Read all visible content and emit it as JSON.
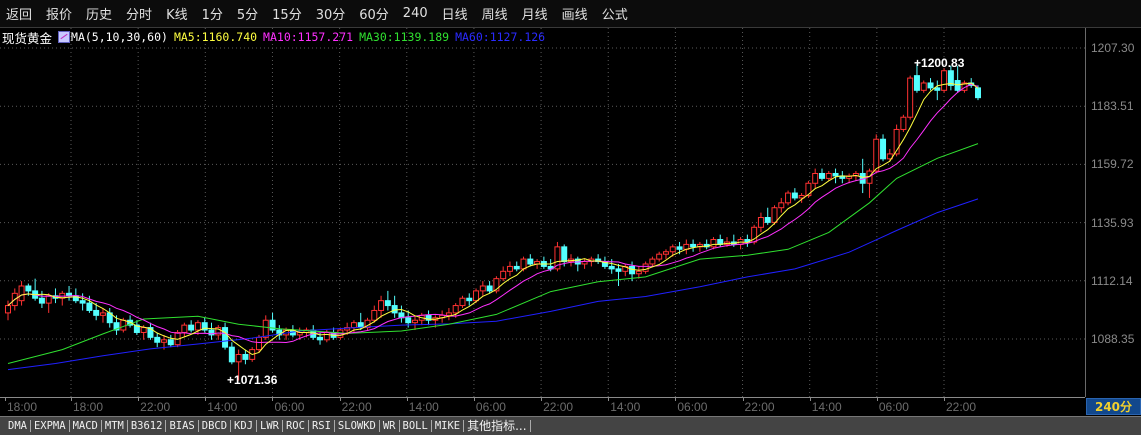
{
  "toolbar": {
    "items": [
      "返回",
      "报价",
      "历史",
      "分时",
      "K线",
      "1分",
      "5分",
      "15分",
      "30分",
      "60分",
      "240",
      "日线",
      "周线",
      "月线",
      "画线",
      "公式"
    ]
  },
  "info": {
    "symbol": "现货黄金",
    "indicator_icon": "indicator-icon",
    "ma_label": "MA(5,10,30,60)",
    "ma5": "MA5:1160.740",
    "ma10": "MA10:1157.271",
    "ma30": "MA30:1139.189",
    "ma60": "MA60:1127.126"
  },
  "period_badge": "240分",
  "indicator_tabs": [
    "DMA",
    "EXPMA",
    "MACD",
    "MTM",
    "B3612",
    "BIAS",
    "DBCD",
    "KDJ",
    "LWR",
    "ROC",
    "RSI",
    "SLOWKD",
    "WR",
    "BOLL",
    "MIKE",
    "其他指标..."
  ],
  "colors": {
    "up": "#ff3232",
    "down": "#54ffff",
    "ma5": "#ffff40",
    "ma10": "#ff30ff",
    "ma30": "#30e030",
    "ma60": "#2020ff",
    "grid": "#5a5a5a"
  },
  "chart_data": {
    "type": "candlestick",
    "y_ticks": [
      "1207.30",
      "1183.51",
      "1159.72",
      "1135.93",
      "1112.14",
      "1088.35"
    ],
    "ylim": [
      1060,
      1215
    ],
    "x_ticks": [
      "18:00",
      "18:00",
      "22:00",
      "14:00",
      "06:00",
      "22:00",
      "14:00",
      "06:00",
      "22:00",
      "14:00",
      "06:00",
      "22:00",
      "14:00",
      "06:00",
      "22:00"
    ],
    "annotations": {
      "high": "1200.83",
      "low": "1071.36"
    },
    "candles_ohlc": [
      [
        1099,
        1104,
        1096,
        1102
      ],
      [
        1102,
        1109,
        1100,
        1107
      ],
      [
        1104,
        1112,
        1102,
        1110
      ],
      [
        1110,
        1111,
        1106,
        1108
      ],
      [
        1108,
        1113,
        1104,
        1105
      ],
      [
        1105,
        1108,
        1101,
        1103
      ],
      [
        1103,
        1107,
        1099,
        1106
      ],
      [
        1106,
        1109,
        1103,
        1105
      ],
      [
        1105,
        1108,
        1102,
        1107
      ],
      [
        1107,
        1110,
        1104,
        1106
      ],
      [
        1106,
        1109,
        1103,
        1104
      ],
      [
        1104,
        1107,
        1100,
        1103
      ],
      [
        1103,
        1106,
        1099,
        1100
      ],
      [
        1100,
        1103,
        1096,
        1098
      ],
      [
        1098,
        1101,
        1095,
        1099
      ],
      [
        1099,
        1101,
        1093,
        1095
      ],
      [
        1095,
        1098,
        1090,
        1092
      ],
      [
        1092,
        1097,
        1091,
        1096
      ],
      [
        1096,
        1098,
        1093,
        1094
      ],
      [
        1094,
        1096,
        1090,
        1091
      ],
      [
        1091,
        1094,
        1088,
        1093
      ],
      [
        1093,
        1095,
        1088,
        1089
      ],
      [
        1089,
        1091,
        1085,
        1087
      ],
      [
        1087,
        1090,
        1084,
        1088
      ],
      [
        1088,
        1090,
        1085,
        1086
      ],
      [
        1086,
        1092,
        1085,
        1091
      ],
      [
        1091,
        1095,
        1089,
        1094
      ],
      [
        1094,
        1096,
        1091,
        1092
      ],
      [
        1092,
        1096,
        1090,
        1095
      ],
      [
        1095,
        1097,
        1091,
        1092
      ],
      [
        1092,
        1095,
        1088,
        1090
      ],
      [
        1090,
        1094,
        1088,
        1093
      ],
      [
        1093,
        1095,
        1084,
        1085
      ],
      [
        1085,
        1087,
        1078,
        1079
      ],
      [
        1079,
        1084,
        1071.36,
        1082
      ],
      [
        1082,
        1084,
        1078,
        1080
      ],
      [
        1080,
        1085,
        1079,
        1084
      ],
      [
        1084,
        1090,
        1083,
        1089
      ],
      [
        1089,
        1098,
        1088,
        1096
      ],
      [
        1096,
        1099,
        1091,
        1092
      ],
      [
        1092,
        1094,
        1088,
        1090
      ],
      [
        1090,
        1093,
        1088,
        1092
      ],
      [
        1092,
        1094,
        1089,
        1090
      ],
      [
        1090,
        1093,
        1088,
        1091
      ],
      [
        1091,
        1093,
        1089,
        1092
      ],
      [
        1092,
        1094,
        1088,
        1089
      ],
      [
        1089,
        1091,
        1086,
        1088
      ],
      [
        1088,
        1092,
        1087,
        1091
      ],
      [
        1091,
        1093,
        1088,
        1089
      ],
      [
        1089,
        1093,
        1088,
        1092
      ],
      [
        1092,
        1095,
        1090,
        1093
      ],
      [
        1093,
        1096,
        1091,
        1095
      ],
      [
        1095,
        1099,
        1092,
        1093
      ],
      [
        1093,
        1097,
        1092,
        1096
      ],
      [
        1096,
        1102,
        1095,
        1100
      ],
      [
        1100,
        1106,
        1097,
        1104
      ],
      [
        1104,
        1108,
        1100,
        1102
      ],
      [
        1102,
        1106,
        1097,
        1099
      ],
      [
        1099,
        1102,
        1095,
        1097
      ],
      [
        1097,
        1100,
        1093,
        1095
      ],
      [
        1095,
        1098,
        1092,
        1096
      ],
      [
        1096,
        1099,
        1094,
        1098
      ],
      [
        1098,
        1100,
        1094,
        1096
      ],
      [
        1096,
        1098,
        1093,
        1097
      ],
      [
        1097,
        1100,
        1095,
        1098
      ],
      [
        1098,
        1101,
        1096,
        1099
      ],
      [
        1099,
        1103,
        1097,
        1102
      ],
      [
        1102,
        1106,
        1101,
        1105
      ],
      [
        1105,
        1107,
        1102,
        1104
      ],
      [
        1104,
        1109,
        1103,
        1108
      ],
      [
        1108,
        1112,
        1106,
        1110
      ],
      [
        1110,
        1112,
        1107,
        1108
      ],
      [
        1108,
        1114,
        1107,
        1113
      ],
      [
        1113,
        1118,
        1112,
        1116
      ],
      [
        1116,
        1120,
        1114,
        1118
      ],
      [
        1118,
        1120,
        1116,
        1117
      ],
      [
        1117,
        1122,
        1116,
        1121
      ],
      [
        1121,
        1123,
        1118,
        1119
      ],
      [
        1119,
        1121,
        1117,
        1120
      ],
      [
        1120,
        1122,
        1117,
        1118
      ],
      [
        1118,
        1121,
        1116,
        1117
      ],
      [
        1117,
        1128,
        1116,
        1126
      ],
      [
        1126,
        1127,
        1118,
        1120
      ],
      [
        1120,
        1123,
        1118,
        1121
      ],
      [
        1121,
        1122,
        1116,
        1119
      ],
      [
        1119,
        1121,
        1117,
        1120
      ],
      [
        1120,
        1122,
        1118,
        1121
      ],
      [
        1121,
        1123,
        1119,
        1120
      ],
      [
        1120,
        1122,
        1117,
        1118
      ],
      [
        1118,
        1121,
        1115,
        1117
      ],
      [
        1117,
        1119,
        1110,
        1116
      ],
      [
        1116,
        1119,
        1114,
        1118
      ],
      [
        1118,
        1120,
        1112,
        1115
      ],
      [
        1115,
        1118,
        1113,
        1116
      ],
      [
        1116,
        1120,
        1115,
        1119
      ],
      [
        1119,
        1122,
        1118,
        1121
      ],
      [
        1121,
        1124,
        1120,
        1123
      ],
      [
        1123,
        1125,
        1121,
        1124
      ],
      [
        1124,
        1127,
        1122,
        1126
      ],
      [
        1126,
        1128,
        1123,
        1125
      ],
      [
        1125,
        1129,
        1123,
        1127
      ],
      [
        1127,
        1129,
        1124,
        1126
      ],
      [
        1126,
        1128,
        1124,
        1127
      ],
      [
        1127,
        1129,
        1125,
        1126
      ],
      [
        1126,
        1130,
        1125,
        1129
      ],
      [
        1129,
        1131,
        1126,
        1127
      ],
      [
        1127,
        1130,
        1126,
        1128
      ],
      [
        1128,
        1131,
        1126,
        1127
      ],
      [
        1127,
        1130,
        1125,
        1129
      ],
      [
        1129,
        1131,
        1126,
        1128
      ],
      [
        1128,
        1135,
        1127,
        1134
      ],
      [
        1134,
        1140,
        1132,
        1138
      ],
      [
        1138,
        1142,
        1135,
        1136
      ],
      [
        1136,
        1143,
        1135,
        1142
      ],
      [
        1142,
        1146,
        1140,
        1144
      ],
      [
        1144,
        1149,
        1143,
        1148
      ],
      [
        1148,
        1150,
        1145,
        1146
      ],
      [
        1146,
        1148,
        1144,
        1147
      ],
      [
        1147,
        1153,
        1146,
        1152
      ],
      [
        1152,
        1158,
        1150,
        1156
      ],
      [
        1156,
        1158,
        1153,
        1154
      ],
      [
        1154,
        1157,
        1153,
        1156
      ],
      [
        1156,
        1158,
        1152,
        1155
      ],
      [
        1155,
        1157,
        1152,
        1154
      ],
      [
        1154,
        1156,
        1152,
        1155
      ],
      [
        1155,
        1157,
        1153,
        1156
      ],
      [
        1156,
        1162,
        1148,
        1152
      ],
      [
        1152,
        1158,
        1146,
        1157
      ],
      [
        1157,
        1172,
        1156,
        1170
      ],
      [
        1170,
        1172,
        1161,
        1162
      ],
      [
        1162,
        1166,
        1161,
        1164
      ],
      [
        1164,
        1176,
        1163,
        1174
      ],
      [
        1174,
        1180,
        1173,
        1179
      ],
      [
        1179,
        1196,
        1178,
        1195
      ],
      [
        1196,
        1200.83,
        1189,
        1190
      ],
      [
        1190,
        1194,
        1189,
        1193
      ],
      [
        1193,
        1195,
        1190,
        1191
      ],
      [
        1191,
        1194,
        1186,
        1190
      ],
      [
        1190,
        1199,
        1189,
        1198
      ],
      [
        1198,
        1200,
        1190,
        1192
      ],
      [
        1194,
        1200,
        1189,
        1190
      ],
      [
        1190,
        1194,
        1189,
        1193
      ],
      [
        1193,
        1195,
        1191,
        1192
      ],
      [
        1191,
        1192,
        1186,
        1187
      ]
    ],
    "ma30_points": [
      [
        0,
        1078.3
      ],
      [
        8,
        1084
      ],
      [
        14,
        1090.4
      ],
      [
        20,
        1096.5
      ],
      [
        28,
        1097.6
      ],
      [
        34,
        1094.4
      ],
      [
        40,
        1092.5
      ],
      [
        50,
        1090.6
      ],
      [
        58,
        1091.6
      ],
      [
        65,
        1094.4
      ],
      [
        72,
        1098.4
      ],
      [
        80,
        1107.7
      ],
      [
        87,
        1111.7
      ],
      [
        94,
        1113.7
      ],
      [
        102,
        1121
      ],
      [
        109,
        1122.6
      ],
      [
        115,
        1125
      ],
      [
        121,
        1131.9
      ],
      [
        127,
        1144
      ],
      [
        131,
        1154
      ],
      [
        137,
        1162.2
      ],
      [
        143,
        1168.2
      ]
    ],
    "ma60_points": [
      [
        0,
        1075.8
      ],
      [
        7,
        1078.3
      ],
      [
        14,
        1081.5
      ],
      [
        21,
        1084.3
      ],
      [
        28,
        1086.3
      ],
      [
        36,
        1088.7
      ],
      [
        43,
        1091.6
      ],
      [
        50,
        1092.8
      ],
      [
        58,
        1094
      ],
      [
        65,
        1094.5
      ],
      [
        72,
        1095.6
      ],
      [
        80,
        1099.6
      ],
      [
        87,
        1103.7
      ],
      [
        94,
        1105.7
      ],
      [
        102,
        1109.7
      ],
      [
        109,
        1113.7
      ],
      [
        116,
        1117
      ],
      [
        124,
        1123.8
      ],
      [
        131,
        1132.7
      ],
      [
        137,
        1140
      ],
      [
        143,
        1145.6
      ]
    ]
  }
}
